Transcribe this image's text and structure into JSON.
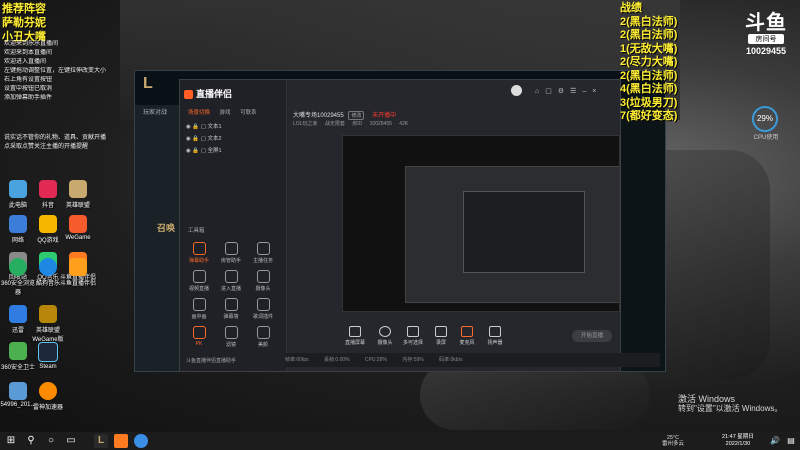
{
  "overlay_left": {
    "line1": "推荐阵容",
    "line2": "萨勒芬妮",
    "line3": "小丑大嘴"
  },
  "overlay_notes": [
    "欢迎来到乐乐直播间",
    "欢迎来到本直播间",
    "欢迎进入直播间",
    "左键拖动调整位置，左键拉伸改变大小",
    "右上角有设置按钮",
    "设置中按钮已取消",
    "添加弹幕助手插件"
  ],
  "overlay_rules": [
    "说实话不管你的礼物、道具、贡献开播",
    "点采取点赞关注主播的开播提醒"
  ],
  "overlay_right": {
    "title": "战绩",
    "records": [
      "2(黑白法师)",
      "2(黑白法师)",
      "1(无敌大嘴)",
      "2(尽力大嘴)",
      "2(黑白法师)",
      "4(黑白法师)",
      "3(垃圾男刀)",
      "7(都好变态)"
    ]
  },
  "douyu": {
    "logo": "斗鱼",
    "tag": "房间号",
    "room_id": "10029455"
  },
  "cpu": {
    "percent": "29%",
    "label": "CPU使用"
  },
  "desktop_icons": [
    {
      "label": "此电脑"
    },
    {
      "label": "抖音"
    },
    {
      "label": "英雄联盟"
    },
    {
      "label": "网络"
    },
    {
      "label": "QQ游戏"
    },
    {
      "label": "WeGame"
    },
    {
      "label": "回收站"
    },
    {
      "label": "QQ音乐"
    },
    {
      "label": "斗鱼直播伴侣"
    },
    {
      "label": "360安全浏览器"
    },
    {
      "label": "酷狗音乐"
    },
    {
      "label": "斗鱼直播伴侣"
    },
    {
      "label": "迅雷"
    },
    {
      "label": "英雄联盟WeGame版"
    },
    {
      "label": "360安全卫士"
    },
    {
      "label": "Steam"
    },
    {
      "label": "54996_201..."
    },
    {
      "label": "雷神加速器"
    }
  ],
  "game": {
    "logo": "L",
    "tab": "玩家对战",
    "call_text": "召唤"
  },
  "stream_app": {
    "brand": "直播伴侣",
    "tabs": [
      "场景切换",
      "游戏",
      "可联系"
    ],
    "scenes": [
      "文本1",
      "文本2",
      "全屏1"
    ],
    "tool_section": "工具箱",
    "tools": [
      "弹幕助手",
      "房管助手",
      "主播任务",
      "视频直播",
      "进入直播",
      "摄像头",
      "画中画",
      "弹幕墙",
      "歌词插件",
      "PK",
      "滤镜",
      "美颜"
    ],
    "room_title": "大嘴专场10029455",
    "room_pill": "修改",
    "room_status": "未开播中",
    "room_meta": [
      "LOL玩之家",
      "战无限套",
      "房ID",
      "10029455",
      "42K"
    ],
    "bottom_hint": "斗鱼直播伴侣直播助手",
    "stream_tools": [
      "直播屏幕",
      "摄像头",
      "多可选择",
      "录屏",
      "麦克风",
      "扬声器"
    ],
    "go_live": "开始直播",
    "status_items": [
      "帧率:60fps",
      "丢帧:0.00%",
      "CPU:28%",
      "内存:59%",
      "码率:0kb/s"
    ]
  },
  "activate": {
    "title": "激活 Windows",
    "sub": "转到\"设置\"以激活 Windows。"
  },
  "taskbar": {
    "temp": "25°C",
    "weather": "雷州多云",
    "time": "21:47 星期日",
    "date": "2022/1/30"
  }
}
